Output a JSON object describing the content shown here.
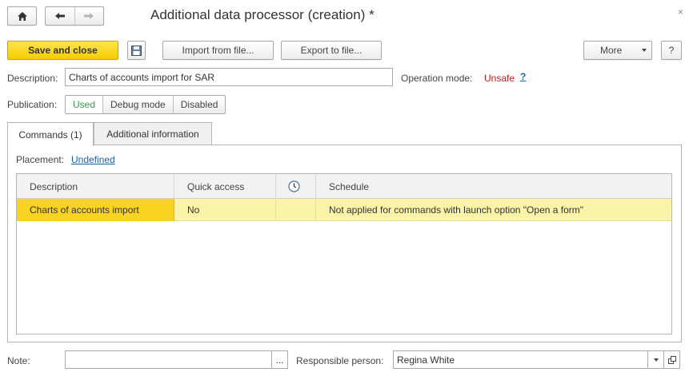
{
  "window": {
    "title": "Additional data processor (creation) *",
    "close_glyph": "×"
  },
  "nav": {
    "home_icon": "home-icon",
    "back_icon": "arrow-left-icon",
    "forward_icon": "arrow-right-icon"
  },
  "toolbar": {
    "save_close_label": "Save and close",
    "save_icon": "floppy-disk-icon",
    "import_label": "Import from file...",
    "export_label": "Export to file...",
    "more_label": "More",
    "help_label": "?"
  },
  "description": {
    "label": "Description:",
    "value": "Charts of accounts import for SAR"
  },
  "operation_mode": {
    "label": "Operation mode:",
    "value": "Unsafe",
    "help": "?",
    "value_color": "#c41a1a"
  },
  "publication": {
    "label": "Publication:",
    "options": [
      "Used",
      "Debug mode",
      "Disabled"
    ],
    "selected": "Used"
  },
  "tabs": [
    {
      "label": "Commands (1)",
      "active": true
    },
    {
      "label": "Additional information",
      "active": false
    }
  ],
  "placement": {
    "label": "Placement:",
    "value": "Undefined"
  },
  "commands_table": {
    "columns": [
      "Description",
      "Quick access",
      "clock-icon",
      "Schedule"
    ],
    "rows": [
      {
        "description": "Charts of accounts import",
        "quick_access": "No",
        "clock": "",
        "schedule": "Not applied for commands with launch option \"Open a form\""
      }
    ]
  },
  "note": {
    "label": "Note:",
    "value": "",
    "picker": "..."
  },
  "responsible": {
    "label": "Responsible person:",
    "value": "Regina White"
  }
}
